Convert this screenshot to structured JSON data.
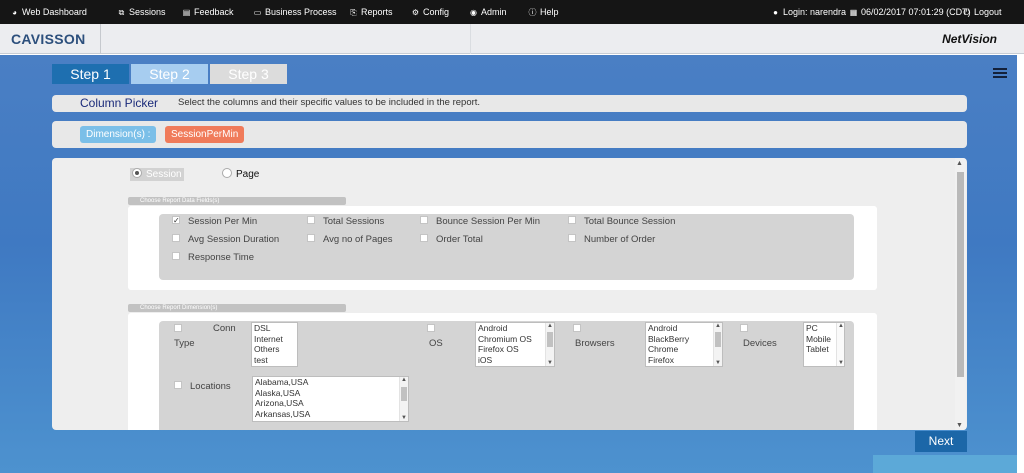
{
  "topnav": {
    "items": [
      {
        "icon": "dashboard-icon",
        "glyph": "◕",
        "label": "Web Dashboard"
      },
      {
        "icon": "sessions-icon",
        "glyph": "⧉",
        "label": "Sessions"
      },
      {
        "icon": "feedback-icon",
        "glyph": "▤",
        "label": "Feedback"
      },
      {
        "icon": "business-process-icon",
        "glyph": "▭",
        "label": "Business Process"
      },
      {
        "icon": "reports-icon",
        "glyph": "⎘",
        "label": "Reports"
      },
      {
        "icon": "config-icon",
        "glyph": "⚙",
        "label": "Config"
      },
      {
        "icon": "admin-icon",
        "glyph": "◉",
        "label": "Admin"
      },
      {
        "icon": "help-icon",
        "glyph": "ⓘ",
        "label": "Help"
      }
    ],
    "login": "Login: narendra",
    "datetime": "06/02/2017 07:01:29 (CDT)",
    "logout": "Logout"
  },
  "brand": {
    "logo": "CAVISSON",
    "product": "NetVision"
  },
  "steps": [
    {
      "label": "Step 1",
      "active": true,
      "color": "#1e6fb0"
    },
    {
      "label": "Step 2",
      "active": false,
      "color": "#a7cdf0"
    },
    {
      "label": "Step 3",
      "active": false,
      "color": "#dcdcdc"
    }
  ],
  "column_picker": {
    "title": "Column Picker",
    "description": "Select the columns and their specific values to be included in the report."
  },
  "dimensions_bar": {
    "label": "Dimension(s) :",
    "chip": "SessionPerMin"
  },
  "radios": {
    "session": "Session",
    "page": "Page",
    "selected": "session"
  },
  "data_fields": {
    "header": "Choose Report Data Fields(s)",
    "items": [
      {
        "label": "Session Per Min",
        "checked": true
      },
      {
        "label": "Total Sessions",
        "checked": false
      },
      {
        "label": "Bounce Session Per Min",
        "checked": false
      },
      {
        "label": "Total Bounce Session",
        "checked": false
      },
      {
        "label": "Avg Session Duration",
        "checked": false
      },
      {
        "label": "Avg no of Pages",
        "checked": false
      },
      {
        "label": "Order Total",
        "checked": false
      },
      {
        "label": "Number of Order",
        "checked": false
      },
      {
        "label": "Response Time",
        "checked": false
      }
    ]
  },
  "dimensions": {
    "header": "Choose Report Dimension(s)",
    "conn_type": {
      "label_line1": "Conn",
      "label_line2": "Type",
      "options": [
        "DSL",
        "Internet",
        "Others",
        "test"
      ]
    },
    "os": {
      "label": "OS",
      "options": [
        "Android",
        "Chromium OS",
        "Firefox OS",
        "iOS"
      ]
    },
    "browsers": {
      "label": "Browsers",
      "options": [
        "Android",
        "BlackBerry",
        "Chrome",
        "Firefox"
      ]
    },
    "devices": {
      "label": "Devices",
      "options": [
        "PC",
        "Mobile",
        "Tablet"
      ]
    },
    "locations": {
      "label": "Locations",
      "options": [
        "Alabama,USA",
        "Alaska,USA",
        "Arizona,USA",
        "Arkansas,USA"
      ]
    }
  },
  "next_label": "Next"
}
